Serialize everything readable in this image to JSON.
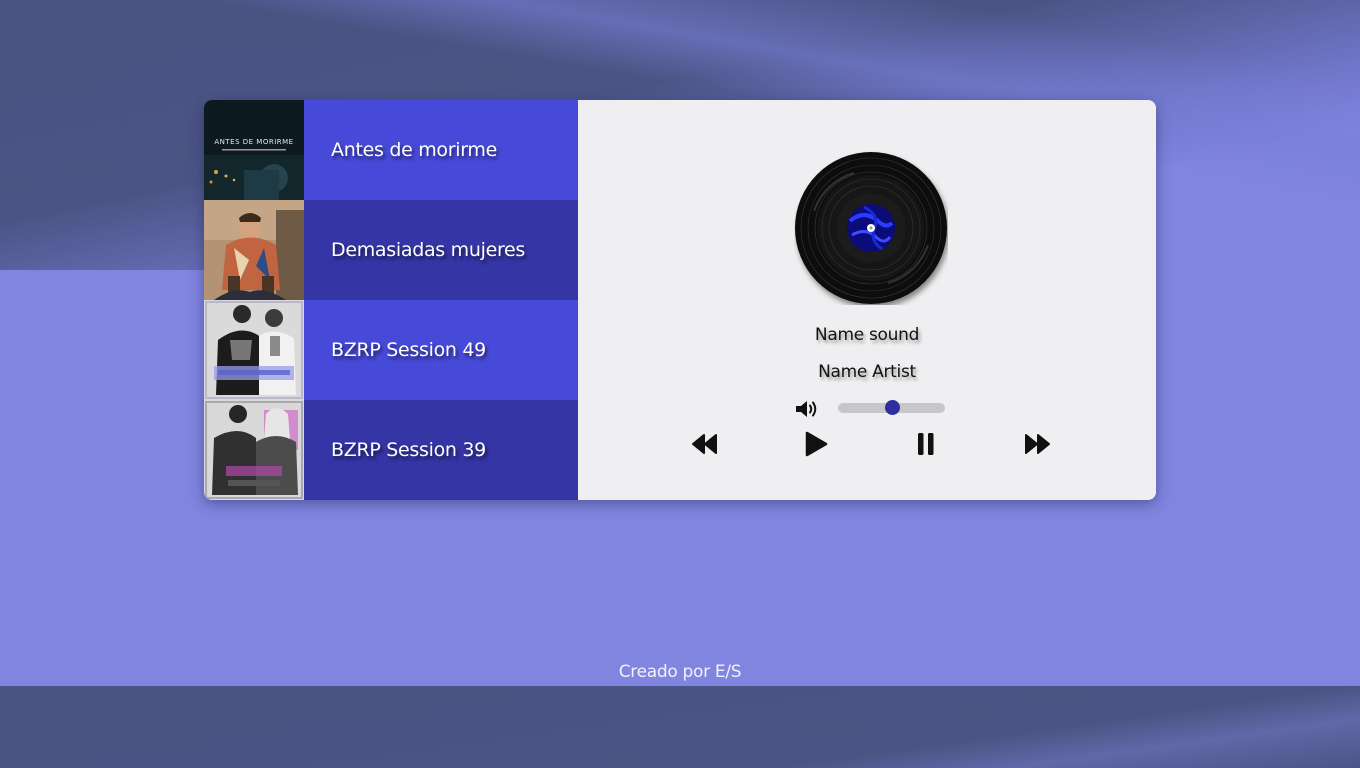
{
  "playlist": [
    {
      "title": "Antes de morirme",
      "cover_text": "ANTES DE MORIRME"
    },
    {
      "title": "Demasiadas mujeres"
    },
    {
      "title": "BZRP Session 49"
    },
    {
      "title": "BZRP Session 39"
    }
  ],
  "now_playing": {
    "name": "Name sound",
    "artist": "Name Artist"
  },
  "volume": {
    "level": 0.5,
    "icon": "volume-up-icon"
  },
  "controls": {
    "prev_icon": "rewind-icon",
    "play_icon": "play-icon",
    "pause_icon": "pause-icon",
    "next_icon": "fast-forward-icon"
  },
  "footer": {
    "credit": "Creado por E/S"
  },
  "colors": {
    "track_odd": "#474ad8",
    "track_even": "#3535a6",
    "panel": "#efeff1",
    "accent": "#2f2e9e"
  }
}
